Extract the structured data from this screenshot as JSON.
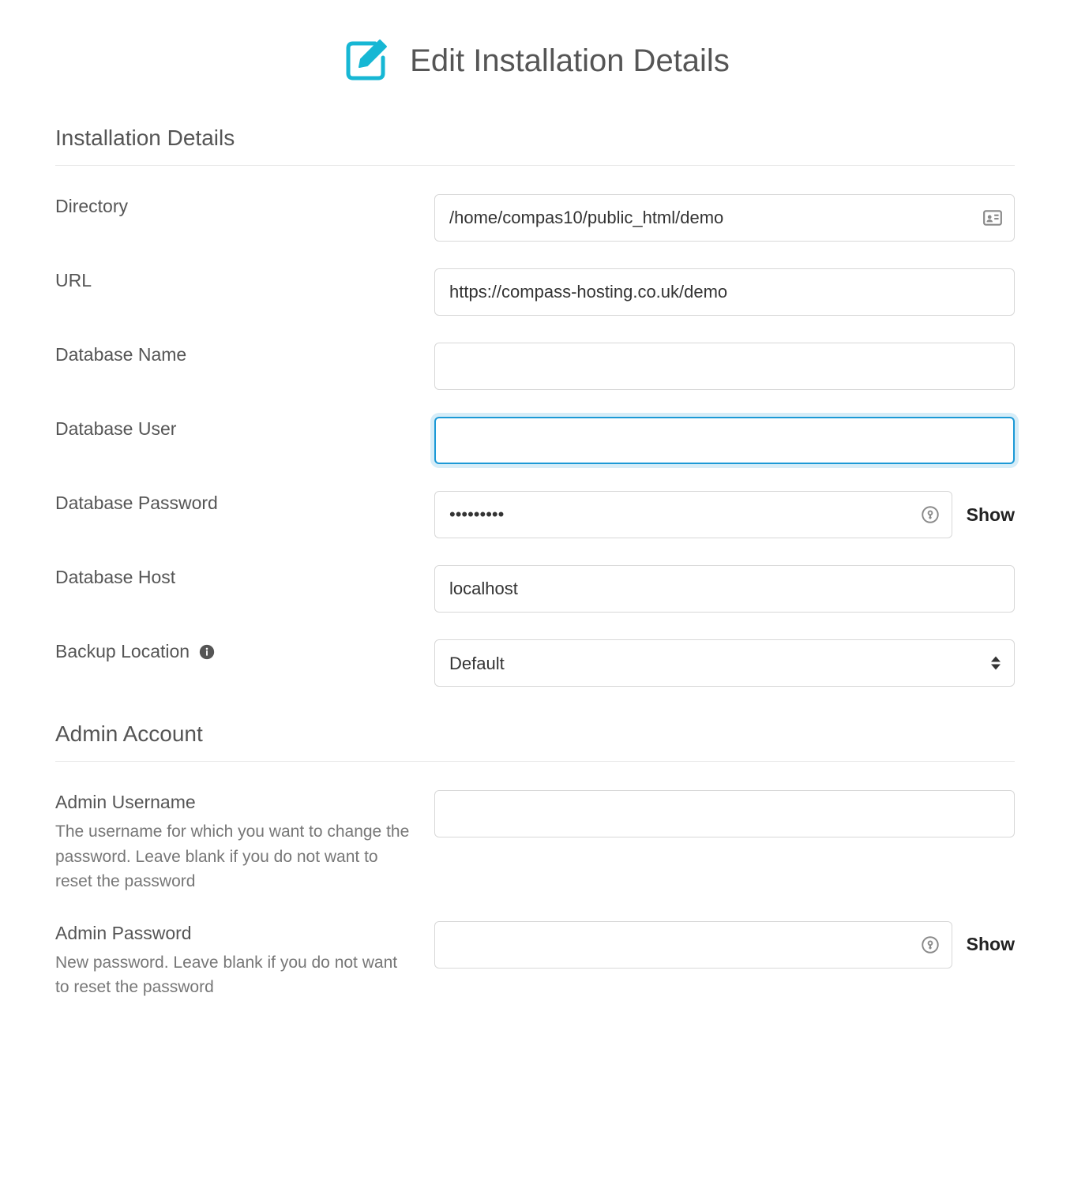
{
  "page": {
    "title": "Edit Installation Details"
  },
  "sections": {
    "installation": {
      "heading": "Installation Details"
    },
    "admin": {
      "heading": "Admin Account"
    }
  },
  "fields": {
    "directory": {
      "label": "Directory",
      "value": "/home/compas10/public_html/demo"
    },
    "url": {
      "label": "URL",
      "value": "https://compass-hosting.co.uk/demo"
    },
    "db_name": {
      "label": "Database Name",
      "value": ""
    },
    "db_user": {
      "label": "Database User",
      "value": ""
    },
    "db_password": {
      "label": "Database Password",
      "value": "•••••••••",
      "show_label": "Show"
    },
    "db_host": {
      "label": "Database Host",
      "value": "localhost"
    },
    "backup": {
      "label": "Backup Location",
      "selected": "Default"
    },
    "admin_user": {
      "label": "Admin Username",
      "help": "The username for which you want to change the password. Leave blank if you do not want to reset the password",
      "value": ""
    },
    "admin_pass": {
      "label": "Admin Password",
      "help": "New password. Leave blank if you do not want to reset the password",
      "value": "",
      "show_label": "Show"
    }
  }
}
